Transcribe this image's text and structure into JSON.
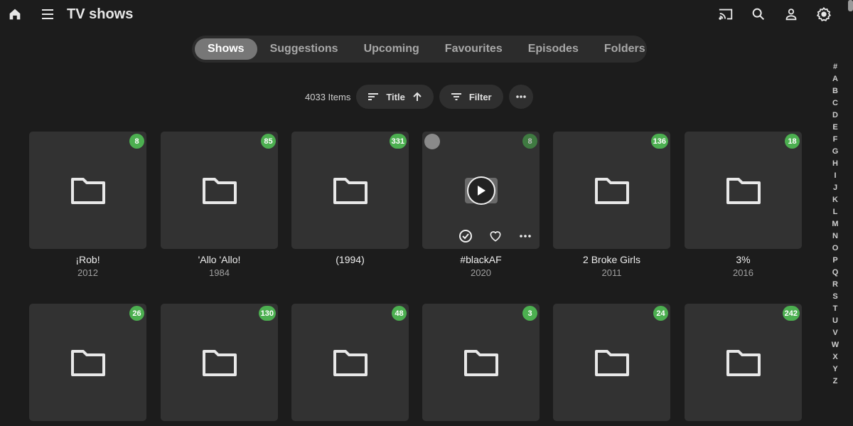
{
  "header": {
    "title": "TV shows",
    "icons": [
      "home-icon",
      "menu-icon",
      "cast-icon",
      "search-icon",
      "user-icon",
      "settings-icon"
    ]
  },
  "tabs": [
    {
      "label": "Shows",
      "active": true
    },
    {
      "label": "Suggestions"
    },
    {
      "label": "Upcoming"
    },
    {
      "label": "Favourites"
    },
    {
      "label": "Episodes"
    },
    {
      "label": "Folders"
    }
  ],
  "toolbar": {
    "count": "4033 Items",
    "sort_label": "Title",
    "filter_label": "Filter"
  },
  "items": [
    {
      "name": "¡Rob!",
      "year": "2012",
      "count": "8"
    },
    {
      "name": "'Allo 'Allo!",
      "year": "1984",
      "count": "85"
    },
    {
      "name": "(1994)",
      "year": "",
      "count": "331"
    },
    {
      "name": "#blackAF",
      "year": "2020",
      "count": "8",
      "hover": true
    },
    {
      "name": "2 Broke Girls",
      "year": "2011",
      "count": "136"
    },
    {
      "name": "3%",
      "year": "2016",
      "count": "18"
    },
    {
      "name": "",
      "year": "",
      "count": "26"
    },
    {
      "name": "",
      "year": "",
      "count": "130"
    },
    {
      "name": "",
      "year": "",
      "count": "48"
    },
    {
      "name": "",
      "year": "",
      "count": "3"
    },
    {
      "name": "",
      "year": "",
      "count": "24"
    },
    {
      "name": "",
      "year": "",
      "count": "242"
    }
  ],
  "alphabet": [
    "#",
    "A",
    "B",
    "C",
    "D",
    "E",
    "F",
    "G",
    "H",
    "I",
    "J",
    "K",
    "L",
    "M",
    "N",
    "O",
    "P",
    "Q",
    "R",
    "S",
    "T",
    "U",
    "V",
    "W",
    "X",
    "Y",
    "Z"
  ],
  "colors": {
    "badge": "#4caf50",
    "background": "#1c1c1c",
    "card": "#323232"
  }
}
